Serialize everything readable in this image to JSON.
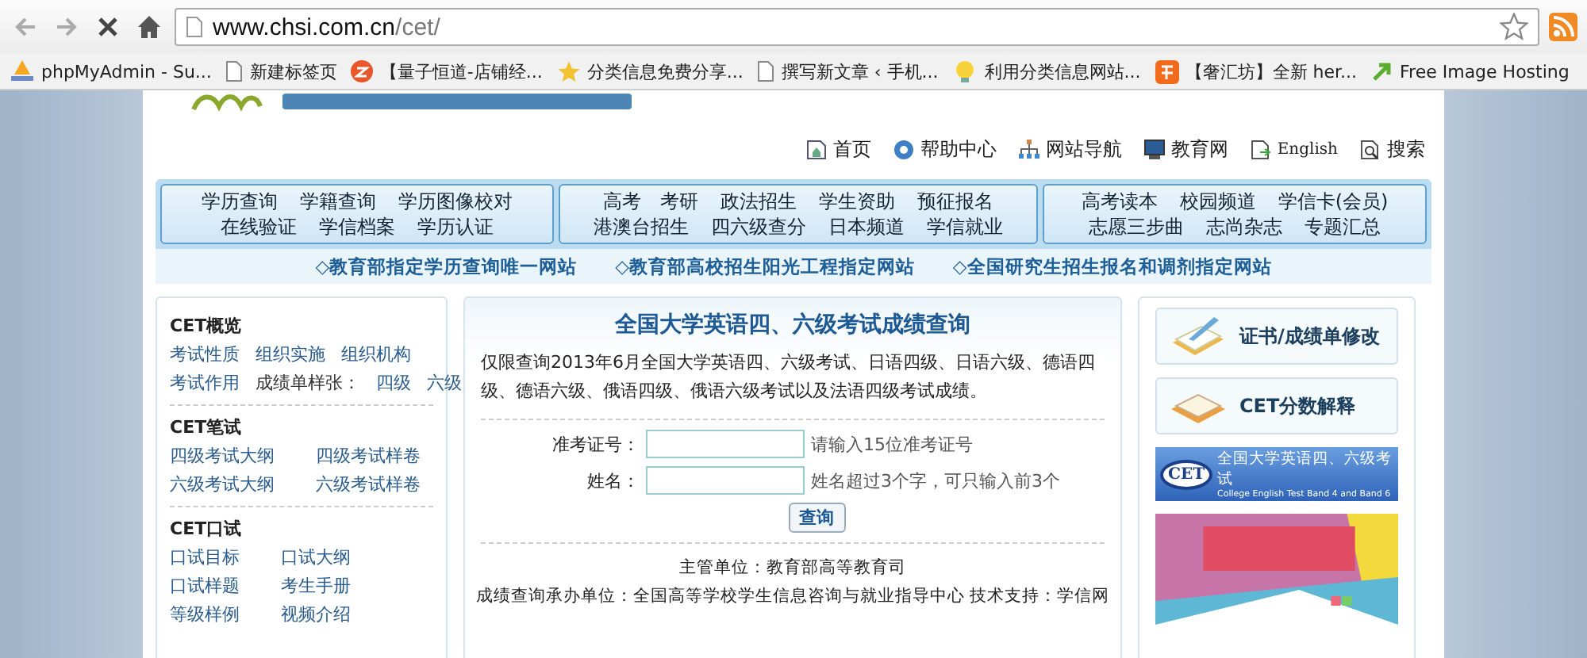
{
  "browser": {
    "url_host": "www.chsi.com.cn",
    "url_path": "/cet/",
    "loading": true,
    "bookmarks": [
      {
        "label": "phpMyAdmin - Su...",
        "kind": "pma"
      },
      {
        "label": "新建标签页",
        "kind": "page"
      },
      {
        "label": "【量子恒道-店铺经...",
        "kind": "orange"
      },
      {
        "label": "分类信息免费分享...",
        "kind": "star"
      },
      {
        "label": "撰写新文章 ‹ 手机...",
        "kind": "page"
      },
      {
        "label": "利用分类信息网站...",
        "kind": "bulb"
      },
      {
        "label": "【奢汇坊】全新 her...",
        "kind": "tao"
      },
      {
        "label": "Free Image Hosting",
        "kind": "arrow"
      }
    ]
  },
  "top_links": [
    {
      "label": "首页",
      "kind": "home"
    },
    {
      "label": "帮助中心",
      "kind": "help"
    },
    {
      "label": "网站导航",
      "kind": "map"
    },
    {
      "label": "教育网",
      "kind": "monitor"
    },
    {
      "label": "English",
      "kind": "doc"
    },
    {
      "label": "搜索",
      "kind": "search"
    }
  ],
  "nav_groups": [
    {
      "rows": [
        [
          "学历查询",
          "学籍查询",
          "学历图像校对"
        ],
        [
          "在线验证",
          "学信档案",
          "学历认证"
        ]
      ]
    },
    {
      "rows": [
        [
          "高考　考研",
          "政法招生",
          "学生资助",
          "预征报名"
        ],
        [
          "港澳台招生",
          "四六级查分",
          "日本频道",
          "学信就业"
        ]
      ]
    },
    {
      "rows": [
        [
          "高考读本",
          "校园频道",
          "学信卡(会员)"
        ],
        [
          "志愿三步曲",
          "志尚杂志",
          "专题汇总"
        ]
      ]
    }
  ],
  "slogans": [
    "◇教育部指定学历查询唯一网站",
    "◇教育部高校招生阳光工程指定网站",
    "◇全国研究生招生报名和调剂指定网站"
  ],
  "sidebar": [
    {
      "title": "CET概览",
      "rows": [
        [
          "考试性质",
          "组织实施",
          "组织机构"
        ],
        [
          "考试作用",
          "成绩单样张：",
          "四级",
          "六级"
        ]
      ]
    },
    {
      "title": "CET笔试",
      "rows": [
        [
          "四级考试大纲",
          "四级考试样卷"
        ],
        [
          "六级考试大纲",
          "六级考试样卷"
        ]
      ]
    },
    {
      "title": "CET口试",
      "rows": [
        [
          "口试目标",
          "口试大纲"
        ],
        [
          "口试样题",
          "考生手册"
        ],
        [
          "等级样例",
          "视频介绍"
        ]
      ]
    }
  ],
  "query": {
    "title": "全国大学英语四、六级考试成绩查询",
    "notice": "仅限查询2013年6月全国大学英语四、六级考试、日语四级、日语六级、德语四级、德语六级、俄语四级、俄语六级考试以及法语四级考试成绩。",
    "fields": [
      {
        "label": "准考证号：",
        "hint": "请输入15位准考证号"
      },
      {
        "label": "姓名：",
        "hint": "姓名超过3个字，可只输入前3个"
      }
    ],
    "button": "查询",
    "footer": [
      "主管单位：教育部高等教育司",
      "成绩查询承办单位：全国高等学校学生信息咨询与就业指导中心  技术支持：学信网"
    ]
  },
  "side_buttons": [
    {
      "label": "证书/成绩单修改",
      "kind": "pencil"
    },
    {
      "label": "CET分数解释",
      "kind": "book"
    }
  ],
  "cet_banner": {
    "logo": "CET",
    "title": "全国大学英语四、六级考试",
    "subtitle": "College English Test Band 4 and Band 6"
  },
  "promo_banner": {
    "kind": "picture"
  }
}
